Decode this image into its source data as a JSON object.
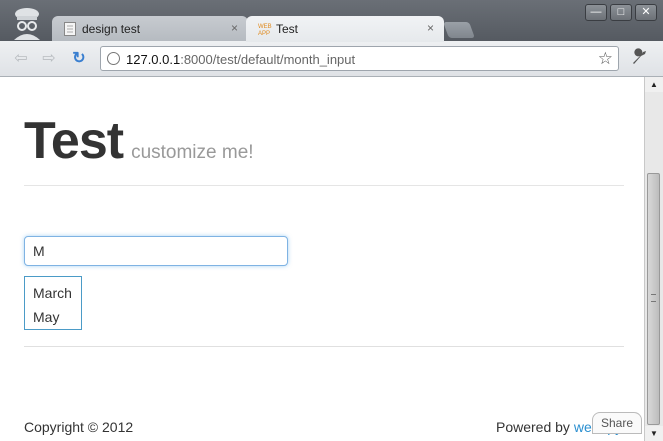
{
  "browser": {
    "tabs": [
      {
        "label": "design test",
        "active": false,
        "close": "×"
      },
      {
        "label": "Test",
        "active": true,
        "close": "×"
      }
    ],
    "address": {
      "host": "127.0.0.1",
      "path": ":8000/test/default/month_input"
    },
    "window_buttons": {
      "minimize": "—",
      "maximize": "□",
      "close": "✕"
    },
    "nav": {
      "back": "⇦",
      "forward": "⇨",
      "reload": "↻",
      "star": "☆",
      "wrench": "🔧"
    }
  },
  "page": {
    "title": "Test",
    "subtitle": "customize me!",
    "month_input": {
      "value": "M"
    },
    "suggestions": [
      "March",
      "May"
    ],
    "footer": {
      "copyright": "Copyright © 2012",
      "powered_by": "Powered by ",
      "brand": "web2py",
      "share": "Share"
    }
  },
  "colors": {
    "accent": "#2a8fd0",
    "focus_border": "#7fb3e3",
    "suggestion_border": "#4b9bc7"
  }
}
